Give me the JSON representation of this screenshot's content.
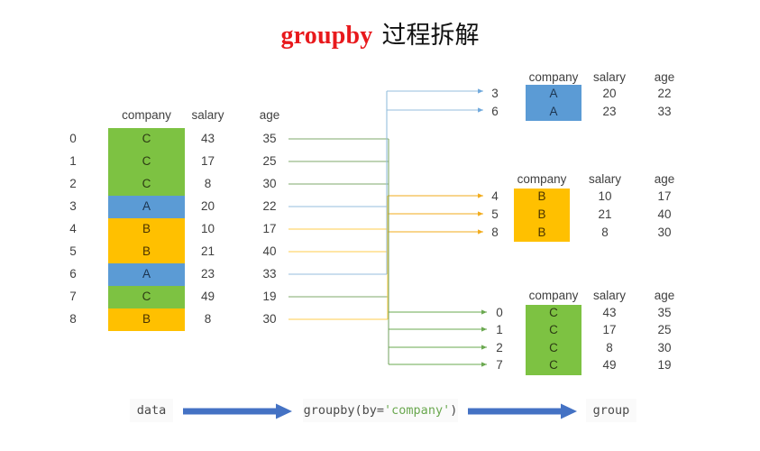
{
  "title": {
    "keyword": "groupby",
    "chinese": "过程拆解"
  },
  "colors": {
    "green": "#7DC242",
    "blue": "#5B9BD5",
    "orange": "#FFC000",
    "title_red": "#E8191C",
    "flow_blue": "#4472C4",
    "line_green": "#7FA96B",
    "line_blue": "#95BEDC",
    "line_orange": "#FFCE4C",
    "text": "#404040"
  },
  "source_table": {
    "name": "data",
    "columns": [
      "company",
      "salary",
      "age"
    ],
    "index": [
      "0",
      "1",
      "2",
      "3",
      "4",
      "5",
      "6",
      "7",
      "8"
    ],
    "rows": [
      {
        "index": "0",
        "company": "C",
        "salary": "43",
        "age": "35",
        "group": "C"
      },
      {
        "index": "1",
        "company": "C",
        "salary": "17",
        "age": "25",
        "group": "C"
      },
      {
        "index": "2",
        "company": "C",
        "salary": "8",
        "age": "30",
        "group": "C"
      },
      {
        "index": "3",
        "company": "A",
        "salary": "20",
        "age": "22",
        "group": "A"
      },
      {
        "index": "4",
        "company": "B",
        "salary": "10",
        "age": "17",
        "group": "B"
      },
      {
        "index": "5",
        "company": "B",
        "salary": "21",
        "age": "40",
        "group": "B"
      },
      {
        "index": "6",
        "company": "A",
        "salary": "23",
        "age": "33",
        "group": "A"
      },
      {
        "index": "7",
        "company": "C",
        "salary": "49",
        "age": "19",
        "group": "C"
      },
      {
        "index": "8",
        "company": "B",
        "salary": "8",
        "age": "30",
        "group": "B"
      }
    ]
  },
  "groups": [
    {
      "key": "A",
      "columns": [
        "company",
        "salary",
        "age"
      ],
      "rows": [
        {
          "index": "3",
          "company": "A",
          "salary": "20",
          "age": "22"
        },
        {
          "index": "6",
          "company": "A",
          "salary": "23",
          "age": "33"
        }
      ]
    },
    {
      "key": "B",
      "columns": [
        "company",
        "salary",
        "age"
      ],
      "rows": [
        {
          "index": "4",
          "company": "B",
          "salary": "10",
          "age": "17"
        },
        {
          "index": "5",
          "company": "B",
          "salary": "21",
          "age": "40"
        },
        {
          "index": "8",
          "company": "B",
          "salary": "8",
          "age": "30"
        }
      ]
    },
    {
      "key": "C",
      "columns": [
        "company",
        "salary",
        "age"
      ],
      "rows": [
        {
          "index": "0",
          "company": "C",
          "salary": "43",
          "age": "35"
        },
        {
          "index": "1",
          "company": "C",
          "salary": "17",
          "age": "25"
        },
        {
          "index": "2",
          "company": "C",
          "salary": "8",
          "age": "30"
        },
        {
          "index": "7",
          "company": "C",
          "salary": "49",
          "age": "19"
        }
      ]
    }
  ],
  "flow": {
    "input_label": "data",
    "operation_prefix": "groupby(by=",
    "operation_arg": "'company'",
    "operation_suffix": ")",
    "output_label": "group"
  }
}
